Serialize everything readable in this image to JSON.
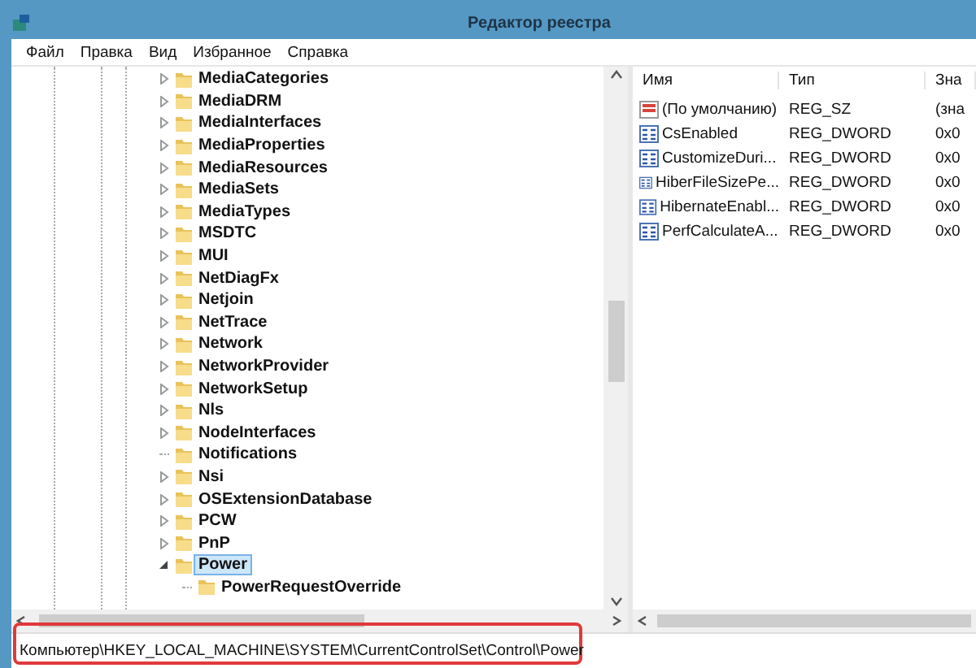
{
  "window": {
    "title": "Редактор реестра"
  },
  "menu": [
    "Файл",
    "Правка",
    "Вид",
    "Избранное",
    "Справка"
  ],
  "tree": [
    {
      "label": "MediaCategories",
      "expandable": true,
      "expanded": false,
      "selected": false
    },
    {
      "label": "MediaDRM",
      "expandable": true,
      "expanded": false,
      "selected": false
    },
    {
      "label": "MediaInterfaces",
      "expandable": true,
      "expanded": false,
      "selected": false
    },
    {
      "label": "MediaProperties",
      "expandable": true,
      "expanded": false,
      "selected": false
    },
    {
      "label": "MediaResources",
      "expandable": true,
      "expanded": false,
      "selected": false
    },
    {
      "label": "MediaSets",
      "expandable": true,
      "expanded": false,
      "selected": false
    },
    {
      "label": "MediaTypes",
      "expandable": true,
      "expanded": false,
      "selected": false
    },
    {
      "label": "MSDTC",
      "expandable": true,
      "expanded": false,
      "selected": false
    },
    {
      "label": "MUI",
      "expandable": true,
      "expanded": false,
      "selected": false
    },
    {
      "label": "NetDiagFx",
      "expandable": true,
      "expanded": false,
      "selected": false
    },
    {
      "label": "Netjoin",
      "expandable": true,
      "expanded": false,
      "selected": false
    },
    {
      "label": "NetTrace",
      "expandable": true,
      "expanded": false,
      "selected": false
    },
    {
      "label": "Network",
      "expandable": true,
      "expanded": false,
      "selected": false
    },
    {
      "label": "NetworkProvider",
      "expandable": true,
      "expanded": false,
      "selected": false
    },
    {
      "label": "NetworkSetup",
      "expandable": true,
      "expanded": false,
      "selected": false
    },
    {
      "label": "Nls",
      "expandable": true,
      "expanded": false,
      "selected": false
    },
    {
      "label": "NodeInterfaces",
      "expandable": true,
      "expanded": false,
      "selected": false
    },
    {
      "label": "Notifications",
      "expandable": false,
      "selected": false
    },
    {
      "label": "Nsi",
      "expandable": true,
      "expanded": false,
      "selected": false
    },
    {
      "label": "OSExtensionDatabase",
      "expandable": true,
      "expanded": false,
      "selected": false
    },
    {
      "label": "PCW",
      "expandable": true,
      "expanded": false,
      "selected": false
    },
    {
      "label": "PnP",
      "expandable": true,
      "expanded": false,
      "selected": false
    },
    {
      "label": "Power",
      "expandable": true,
      "expanded": true,
      "selected": true,
      "children": [
        {
          "label": "PowerRequestOverride",
          "expandable": false,
          "selected": false
        }
      ]
    }
  ],
  "values": {
    "columns": [
      "Имя",
      "Тип",
      "Зна"
    ],
    "rows": [
      {
        "kind": "string",
        "name": "(По умолчанию)",
        "type": "REG_SZ",
        "data": "(зна"
      },
      {
        "kind": "binary",
        "name": "CsEnabled",
        "type": "REG_DWORD",
        "data": "0x0"
      },
      {
        "kind": "binary",
        "name": "CustomizeDuri...",
        "type": "REG_DWORD",
        "data": "0x0"
      },
      {
        "kind": "binary",
        "name": "HiberFileSizePe...",
        "type": "REG_DWORD",
        "data": "0x0"
      },
      {
        "kind": "binary",
        "name": "HibernateEnabl...",
        "type": "REG_DWORD",
        "data": "0x0"
      },
      {
        "kind": "binary",
        "name": "PerfCalculateA...",
        "type": "REG_DWORD",
        "data": "0x0"
      }
    ]
  },
  "status_bar": {
    "path": "Компьютер\\HKEY_LOCAL_MACHINE\\SYSTEM\\CurrentControlSet\\Control\\Power",
    "highlighted": true
  }
}
